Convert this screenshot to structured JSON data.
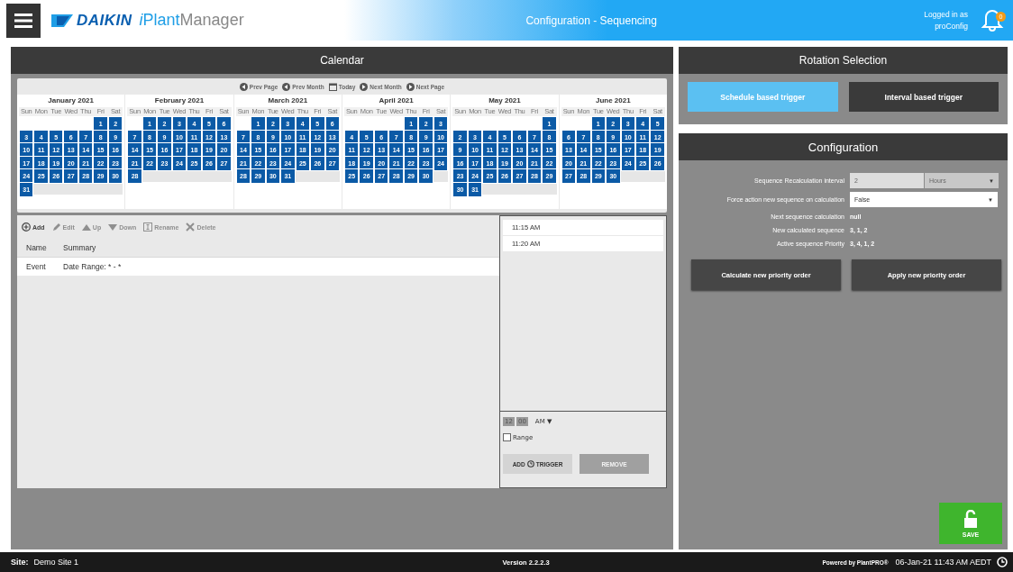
{
  "header": {
    "brand": "DAIKIN",
    "product_prefix": "i",
    "product_main": "Plant",
    "product_suffix": "Manager",
    "title": "Configuration - Sequencing",
    "login_label": "Logged in as",
    "user": "proConfig",
    "notifications": "0"
  },
  "calendar": {
    "title": "Calendar",
    "nav": [
      {
        "kind": "prev-page",
        "label": "Prev Page"
      },
      {
        "kind": "prev-month",
        "label": "Prev Month"
      },
      {
        "kind": "today",
        "label": "Today"
      },
      {
        "kind": "next-month",
        "label": "Next Month"
      },
      {
        "kind": "next-page",
        "label": "Next Page"
      }
    ],
    "months": [
      {
        "name": "January 2021",
        "days_selected": true,
        "weekdays": [
          "Sun",
          "Mon",
          "Tue",
          "Wed",
          "Thu",
          "Fri",
          "Sat"
        ],
        "weeks": [
          [
            "1",
            "2"
          ],
          [
            "3",
            "4",
            "5",
            "6",
            "7",
            "8",
            "9"
          ],
          [
            "10",
            "11",
            "12",
            "13",
            "14",
            "15",
            "16"
          ],
          [
            "17",
            "18",
            "19",
            "20",
            "21",
            "22",
            "23"
          ],
          [
            "24",
            "25",
            "26",
            "27",
            "28",
            "29",
            "30"
          ],
          [
            "31"
          ]
        ]
      },
      {
        "name": "February 2021",
        "days_selected": true,
        "weekdays": [
          "Sun",
          "Mon",
          "Tue",
          "Wed",
          "Thu",
          "Fri",
          "Sat"
        ],
        "weeks": [
          [
            "1",
            "2",
            "3",
            "4",
            "5",
            "6"
          ],
          [
            "7",
            "8",
            "9",
            "10",
            "11",
            "12",
            "13"
          ],
          [
            "14",
            "15",
            "16",
            "17",
            "18",
            "19",
            "20"
          ],
          [
            "21",
            "22",
            "23",
            "24",
            "25",
            "26",
            "27"
          ],
          [
            "28"
          ]
        ]
      },
      {
        "name": "March 2021",
        "days_selected": true,
        "weekdays": [
          "Sun",
          "Mon",
          "Tue",
          "Wed",
          "Thu",
          "Fri",
          "Sat"
        ],
        "weeks": [
          [
            "1",
            "2",
            "3",
            "4",
            "5",
            "6"
          ],
          [
            "7",
            "8",
            "9",
            "10",
            "11",
            "12",
            "13"
          ],
          [
            "14",
            "15",
            "16",
            "17",
            "18",
            "19",
            "20"
          ],
          [
            "21",
            "22",
            "23",
            "24",
            "25",
            "26",
            "27"
          ],
          [
            "28",
            "29",
            "30",
            "31"
          ]
        ]
      },
      {
        "name": "April 2021",
        "days_selected": true,
        "weekdays": [
          "Sun",
          "Mon",
          "Tue",
          "Wed",
          "Thu",
          "Fri",
          "Sat"
        ],
        "weeks": [
          [
            "1",
            "2",
            "3"
          ],
          [
            "4",
            "5",
            "6",
            "7",
            "8",
            "9",
            "10"
          ],
          [
            "11",
            "12",
            "13",
            "14",
            "15",
            "16",
            "17"
          ],
          [
            "18",
            "19",
            "20",
            "21",
            "22",
            "23",
            "24"
          ],
          [
            "25",
            "26",
            "27",
            "28",
            "29",
            "30"
          ]
        ]
      },
      {
        "name": "May 2021",
        "days_selected": true,
        "weekdays": [
          "Sun",
          "Mon",
          "Tue",
          "Wed",
          "Thu",
          "Fri",
          "Sat"
        ],
        "weeks": [
          [
            "1"
          ],
          [
            "2",
            "3",
            "4",
            "5",
            "6",
            "7",
            "8"
          ],
          [
            "9",
            "10",
            "11",
            "12",
            "13",
            "14",
            "15"
          ],
          [
            "16",
            "17",
            "18",
            "19",
            "20",
            "21",
            "22"
          ],
          [
            "23",
            "24",
            "25",
            "26",
            "27",
            "28",
            "29"
          ],
          [
            "30",
            "31"
          ]
        ]
      },
      {
        "name": "June 2021",
        "days_selected": true,
        "weekdays": [
          "Sun",
          "Mon",
          "Tue",
          "Wed",
          "Thu",
          "Fri",
          "Sat"
        ],
        "weeks": [
          [
            "1",
            "2",
            "3",
            "4",
            "5"
          ],
          [
            "6",
            "7",
            "8",
            "9",
            "10",
            "11",
            "12"
          ],
          [
            "13",
            "14",
            "15",
            "16",
            "17",
            "18",
            "19"
          ],
          [
            "20",
            "21",
            "22",
            "23",
            "24",
            "25",
            "26"
          ],
          [
            "27",
            "28",
            "29",
            "30"
          ]
        ]
      }
    ]
  },
  "events": {
    "toolbar": [
      {
        "kind": "add",
        "label": "Add",
        "disabled": false
      },
      {
        "kind": "edit",
        "label": "Edit",
        "disabled": true
      },
      {
        "kind": "up",
        "label": "Up",
        "disabled": true
      },
      {
        "kind": "down",
        "label": "Down",
        "disabled": true
      },
      {
        "kind": "rename",
        "label": "Rename",
        "disabled": true
      },
      {
        "kind": "delete",
        "label": "Delete",
        "disabled": true
      }
    ],
    "columns": [
      "Name",
      "Summary"
    ],
    "rows": [
      {
        "name": "Event",
        "summary": "Date Range: * - *"
      }
    ]
  },
  "triggers": {
    "times": [
      {
        "label": "11:15 AM",
        "selected": false
      },
      {
        "label": "11:20 AM",
        "selected": false
      }
    ],
    "hour": "12",
    "minute": "00",
    "ampm": "AM",
    "ampm_caret": "▼",
    "range": {
      "label": "Range",
      "checked": false
    },
    "buttons": [
      {
        "kind": "add",
        "before": "ADD",
        "after": "TRIGGER",
        "disabled": false
      },
      {
        "kind": "remove",
        "before": "REMOVE",
        "disabled": true
      }
    ]
  },
  "rotation": {
    "title": "Rotation Selection",
    "options": [
      {
        "label": "Schedule based trigger",
        "selected": true
      },
      {
        "label": "Interval based trigger",
        "selected": false
      }
    ]
  },
  "configuration": {
    "title": "Configuration",
    "rows": [
      {
        "kind": "interval",
        "label": "Sequence Recalculation interval",
        "value": "2",
        "unit": "Hours",
        "caret": "▼"
      },
      {
        "kind": "select",
        "label": "Force action new sequence on calculation",
        "value": "False",
        "caret": "▼"
      },
      {
        "kind": "text",
        "label": "Next sequence calculation",
        "value": "null"
      },
      {
        "kind": "text",
        "label": "New calculated sequence",
        "value": "3, 1, 2"
      },
      {
        "kind": "text",
        "label": "Active sequence Priority",
        "value": "3, 4, 1, 2"
      }
    ],
    "buttons": [
      "Calculate new priority order",
      "Apply new priority order"
    ]
  },
  "save": {
    "label": "SAVE"
  },
  "status_bar": {
    "site_label": "Site:",
    "site": "Demo Site 1",
    "version": "Version 2.2.2.3",
    "powered_by": "Powered by PlantPRO®",
    "datetime": "06-Jan-21 11:43 AM AEDT"
  }
}
